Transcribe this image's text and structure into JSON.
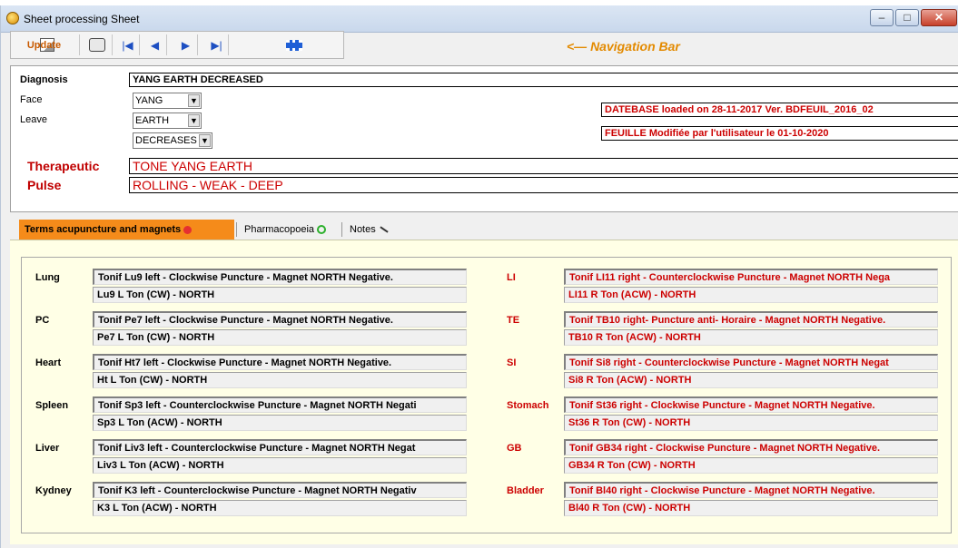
{
  "window": {
    "title": "Sheet processing Sheet",
    "controls": {
      "minimize": "–",
      "maximize": "□",
      "close": "✕"
    }
  },
  "toolbar": {
    "update_label": "Update",
    "nav_first": "|◀",
    "nav_prev": "◀",
    "nav_next": "▶",
    "nav_last": "▶|",
    "navigation_note": "<— Navigation Bar"
  },
  "form": {
    "diagnosis_label": "Diagnosis",
    "diagnosis_value": "YANG EARTH DECREASED",
    "face_label": "Face",
    "face_value": "YANG",
    "leave_label": "Leave",
    "leave_value": "EARTH",
    "direction_value": "DECREASES",
    "therapeutic_label": "Therapeutic",
    "therapeutic_value": "TONE YANG EARTH",
    "pulse_label": "Pulse",
    "pulse_value": "ROLLING - WEAK - DEEP",
    "database_info": "DATEBASE loaded on 28-11-2017 Ver. BDFEUIL_2016_02",
    "modified_info": "FEUILLE Modifiée par l'utilisateur le 01-10-2020"
  },
  "tabs": [
    {
      "label": "Terms acupuncture and magnets",
      "active": true,
      "icon": "pin-icon"
    },
    {
      "label": "Pharmacopoeia",
      "active": false,
      "icon": "ring-icon"
    },
    {
      "label": "Notes",
      "active": false,
      "icon": "pen-icon"
    }
  ],
  "yin_points": [
    {
      "organ": "Lung",
      "line1": "Tonif Lu9 left - Clockwise Puncture - Magnet NORTH Negative.",
      "line2": "Lu9 L Ton (CW) - NORTH"
    },
    {
      "organ": "PC",
      "line1": "Tonif Pe7 left - Clockwise Puncture - Magnet NORTH Negative.",
      "line2": "Pe7 L Ton (CW) - NORTH"
    },
    {
      "organ": "Heart",
      "line1": "Tonif Ht7 left - Clockwise Puncture - Magnet NORTH Negative.",
      "line2": "Ht L Ton (CW) - NORTH"
    },
    {
      "organ": "Spleen",
      "line1": "Tonif Sp3 left - Counterclockwise Puncture - Magnet NORTH Negati",
      "line2": "Sp3 L Ton (ACW) - NORTH"
    },
    {
      "organ": "Liver",
      "line1": "Tonif Liv3 left - Counterclockwise Puncture - Magnet NORTH Negat",
      "line2": "Liv3 L Ton (ACW) - NORTH"
    },
    {
      "organ": "Kydney",
      "line1": "Tonif K3 left - Counterclockwise Puncture - Magnet NORTH Negativ",
      "line2": "K3 L Ton (ACW) - NORTH"
    }
  ],
  "yang_points": [
    {
      "organ": "LI",
      "line1": "Tonif LI11 right - Counterclockwise Puncture - Magnet NORTH Nega",
      "line2": "LI11 R Ton (ACW) - NORTH"
    },
    {
      "organ": "TE",
      "line1": "Tonif TB10 right- Puncture anti- Horaire - Magnet NORTH Negative.",
      "line2": "TB10 R Ton (ACW) - NORTH"
    },
    {
      "organ": "SI",
      "line1": "Tonif Si8 right - Counterclockwise Puncture - Magnet NORTH Negat",
      "line2": "Si8 R Ton (ACW) - NORTH"
    },
    {
      "organ": "Stomach",
      "line1": "Tonif St36 right - Clockwise Puncture - Magnet NORTH Negative.",
      "line2": "St36 R Ton (CW) - NORTH"
    },
    {
      "organ": "GB",
      "line1": "Tonif GB34 right - Clockwise Puncture - Magnet NORTH Negative.",
      "line2": "GB34 R Ton (CW) - NORTH"
    },
    {
      "organ": "Bladder",
      "line1": "Tonif Bl40 right - Clockwise Puncture - Magnet NORTH Negative.",
      "line2": "Bl40 R Ton (CW) - NORTH"
    }
  ],
  "colors": {
    "accent_orange": "#f58b1a",
    "text_red": "#cc0000",
    "panel_bg": "#ffffe6"
  }
}
